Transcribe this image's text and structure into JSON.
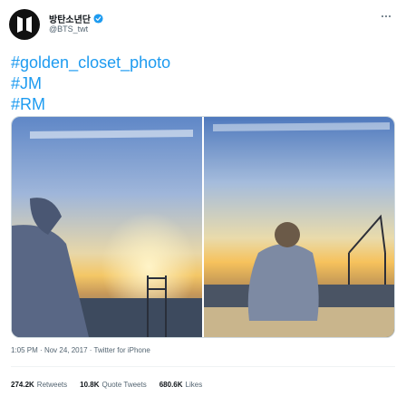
{
  "author": {
    "display_name": "방탄소년단",
    "handle": "@BTS_twt",
    "avatar_icon": "bts-logo-icon",
    "verified_icon": "verified-badge-icon",
    "verified_color": "#1d9bf0"
  },
  "more_icon": "more-dots-icon",
  "tweet": {
    "hashtags": [
      "#golden_closet_photo",
      "#JM",
      "#RM"
    ],
    "hashtag_color": "#1d9bf0"
  },
  "media": {
    "photos": [
      {
        "description_icon": "photo-jm"
      },
      {
        "description_icon": "photo-rm"
      }
    ]
  },
  "meta": {
    "time": "1:05 PM",
    "separator": "·",
    "date": "Nov 24, 2017",
    "source": "Twitter for iPhone"
  },
  "stats": [
    {
      "value": "274.2K",
      "label": "Retweets"
    },
    {
      "value": "10.8K",
      "label": "Quote Tweets"
    },
    {
      "value": "680.6K",
      "label": "Likes"
    }
  ]
}
